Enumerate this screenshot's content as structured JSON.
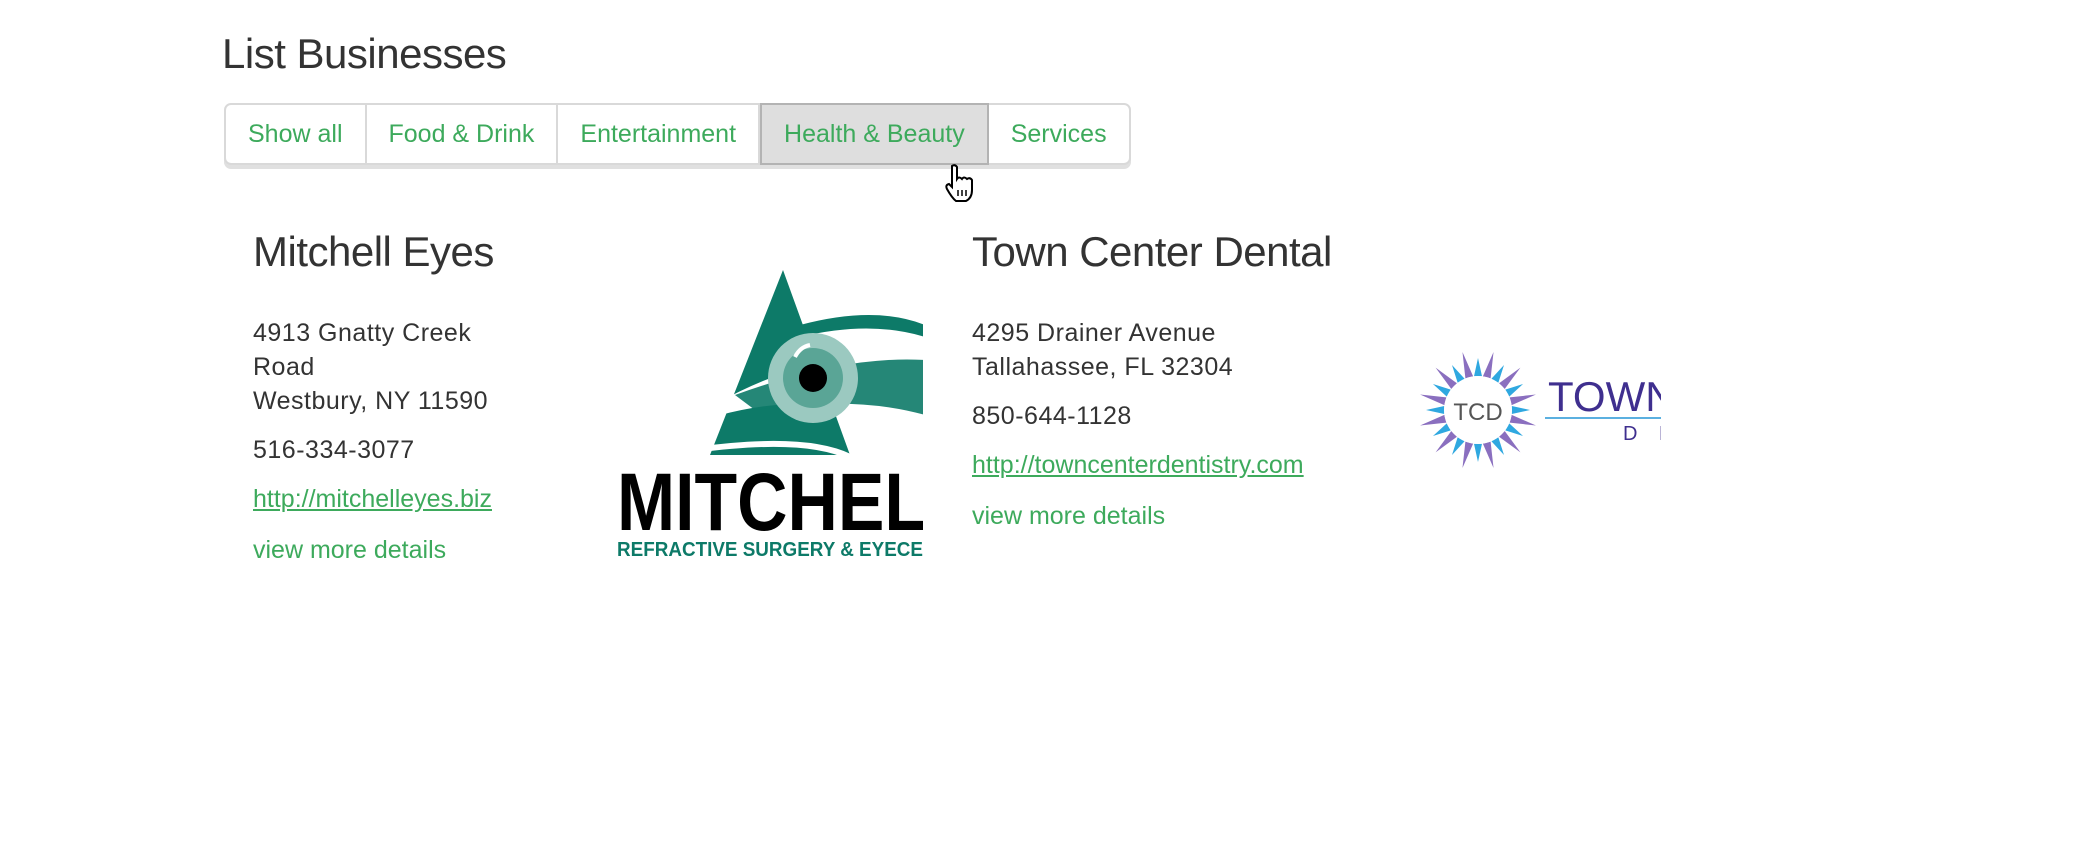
{
  "page": {
    "title": "List Businesses"
  },
  "filters": {
    "items": [
      {
        "label": "Show all",
        "active": false
      },
      {
        "label": "Food & Drink",
        "active": false
      },
      {
        "label": "Entertainment",
        "active": false
      },
      {
        "label": "Health & Beauty",
        "active": true
      },
      {
        "label": "Services",
        "active": false
      }
    ]
  },
  "businesses": [
    {
      "name": "Mitchell Eyes",
      "address_line1": "4913 Gnatty Creek",
      "address_line2": "Road",
      "address_line3": "Westbury, NY 11590",
      "phone": "516-334-3077",
      "url": "http://mitchelleyes.biz",
      "more_label": "view more details",
      "logo": {
        "wordmark": "MITCHEL",
        "tagline": "REFRACTIVE SURGERY & EYECE",
        "icon": "eye-triangle-logo"
      }
    },
    {
      "name": "Town Center Dental",
      "address_line1": "4295 Drainer Avenue",
      "address_line2": "Tallahassee, FL 32304",
      "phone": "850-644-1128",
      "url": "http://towncenterdentistry.com",
      "more_label": "view more details",
      "logo": {
        "badge": "TCD",
        "wordmark": "TOWN",
        "sub": "D E",
        "icon": "starburst-logo"
      }
    }
  ],
  "colors": {
    "accent": "#3daa5c",
    "text": "#333333",
    "active_bg": "#dedede"
  }
}
